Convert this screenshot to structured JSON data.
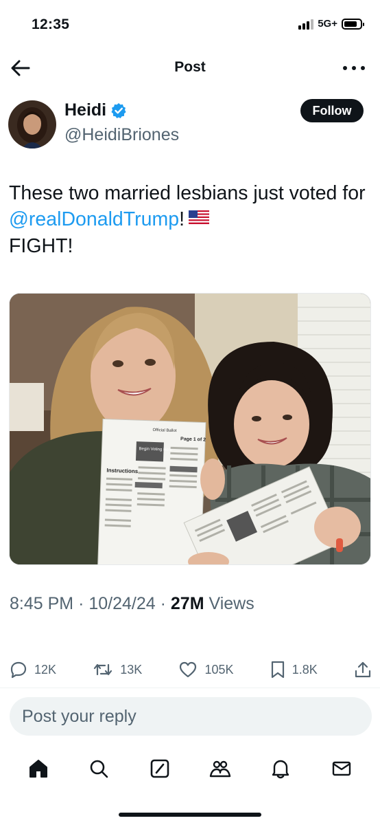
{
  "status_bar": {
    "time": "12:35",
    "network": "5G+"
  },
  "header": {
    "title": "Post"
  },
  "author": {
    "name": "Heidi",
    "handle": "@HeidiBriones",
    "verified": true,
    "follow_label": "Follow"
  },
  "tweet": {
    "text_before": "These two married lesbians just voted for ",
    "mention": "@realDonaldTrump",
    "text_after": "!",
    "text_end": "FIGHT!",
    "flag_icon": "us-flag-emoji"
  },
  "media": {
    "ballot_header": "Official Ballot",
    "ballot_page": "Page 1 of 2",
    "ballot_section": "Instructions",
    "ballot_start": "Begin Voting Here"
  },
  "meta": {
    "time": "8:45 PM",
    "date": "10/24/24",
    "views_count": "27M",
    "views_label": "Views"
  },
  "actions": {
    "replies": "12K",
    "reposts": "13K",
    "likes": "105K",
    "bookmarks": "1.8K"
  },
  "reply": {
    "placeholder": "Post your reply"
  },
  "tabs": [
    "home-icon",
    "search-icon",
    "grok-icon",
    "communities-icon",
    "notifications-icon",
    "messages-icon"
  ],
  "colors": {
    "accent": "#1d9bf0",
    "text": "#0f1419",
    "secondary": "#536471"
  }
}
